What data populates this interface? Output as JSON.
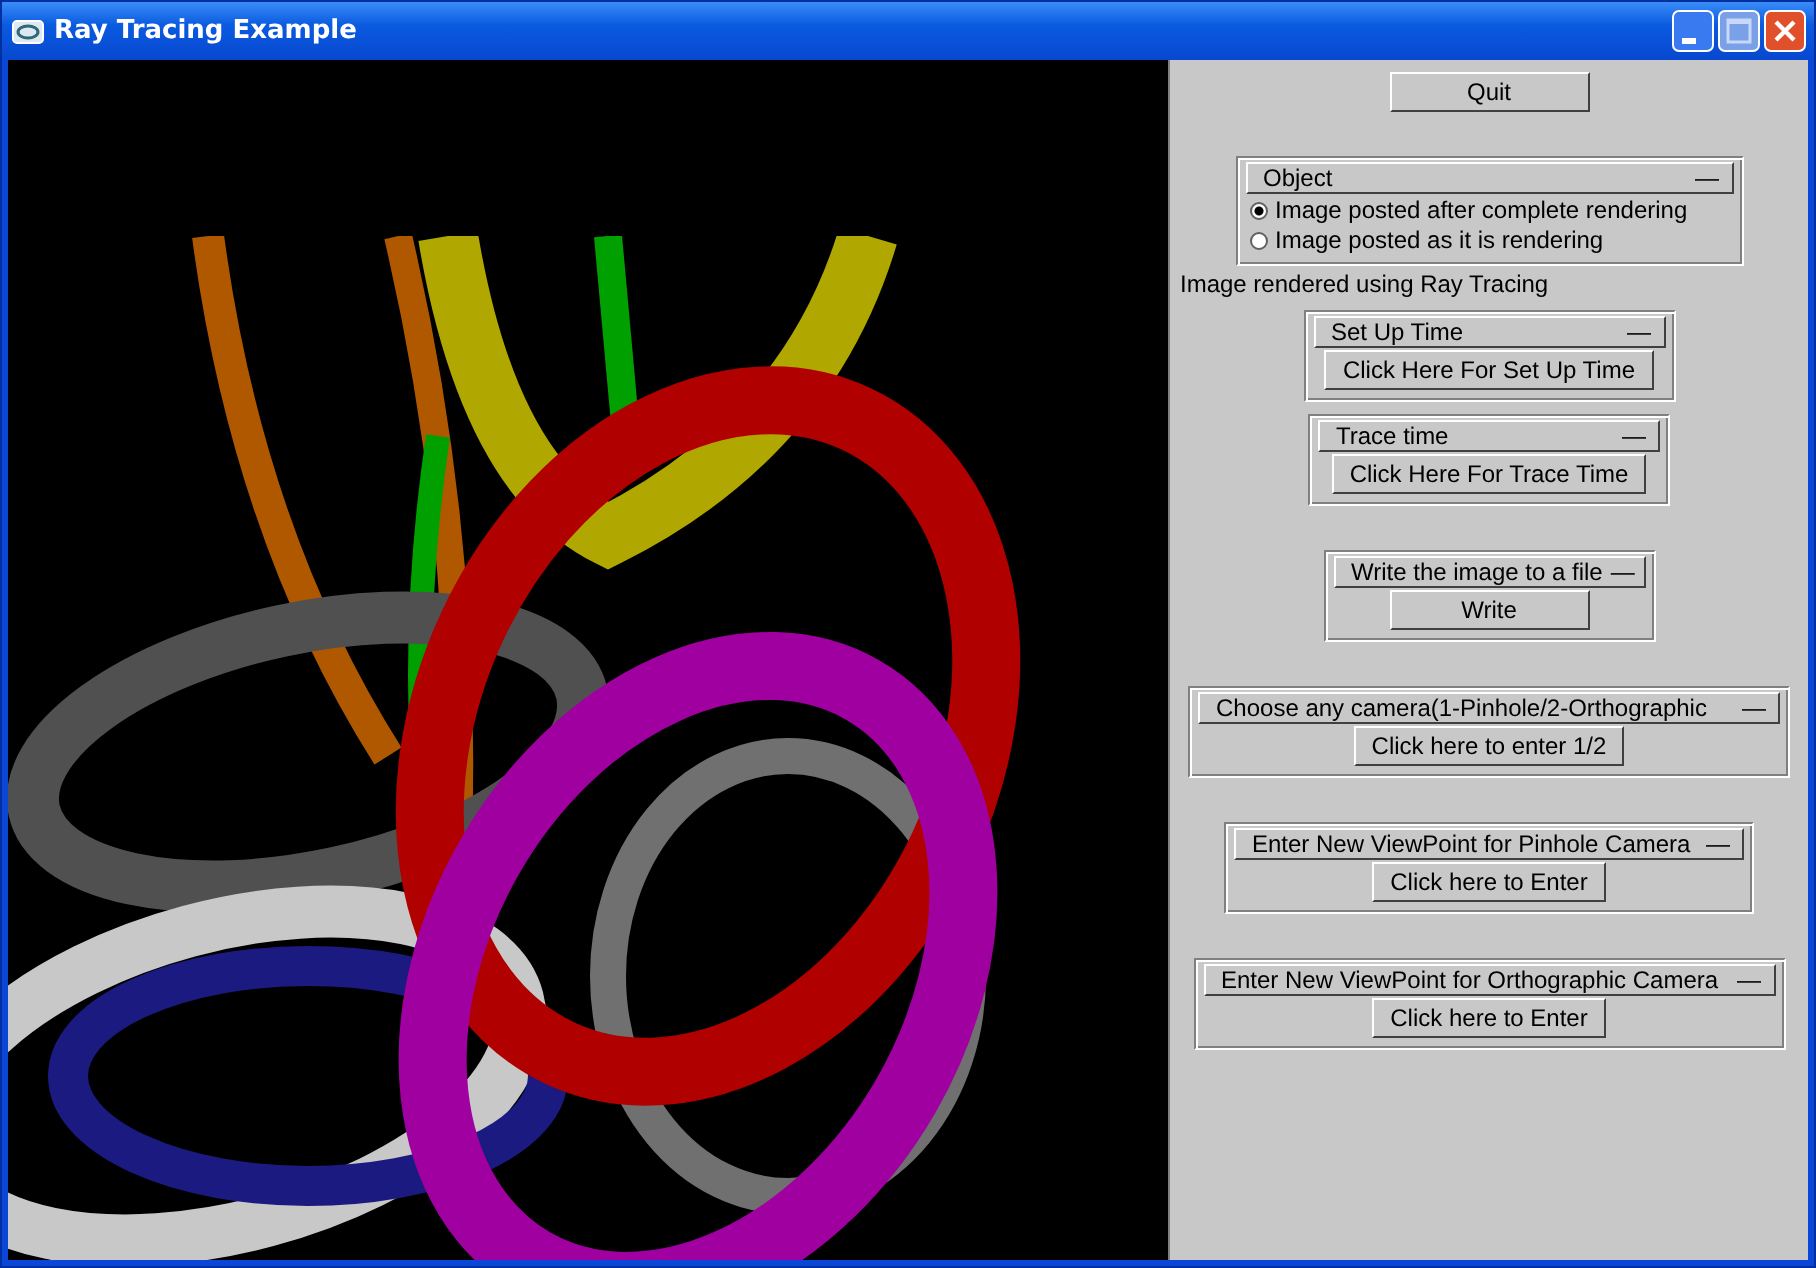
{
  "window": {
    "title": "Ray Tracing Example"
  },
  "quit_button": "Quit",
  "object_panel": {
    "title": "Object",
    "collapse": "—",
    "options": [
      {
        "label": "Image posted after complete rendering",
        "selected": true
      },
      {
        "label": "Image posted as it is rendering",
        "selected": false
      }
    ]
  },
  "status_text": "Image rendered using Ray Tracing",
  "panels": [
    {
      "title": "Set Up Time",
      "collapse": "—",
      "button": "Click Here For Set Up Time"
    },
    {
      "title": "Trace time",
      "collapse": "—",
      "button": "Click Here For Trace Time"
    },
    {
      "title": "Write the image to a file",
      "collapse": "—",
      "button": "Write"
    },
    {
      "title": "Choose any camera(1-Pinhole/2-Orthographic",
      "collapse": "—",
      "button": "Click here to enter 1/2"
    },
    {
      "title": "Enter New ViewPoint for Pinhole Camera",
      "collapse": "—",
      "button": "Click here to Enter"
    },
    {
      "title": "Enter New ViewPoint for Orthographic Camera",
      "collapse": "—",
      "button": "Click here to Enter"
    }
  ]
}
